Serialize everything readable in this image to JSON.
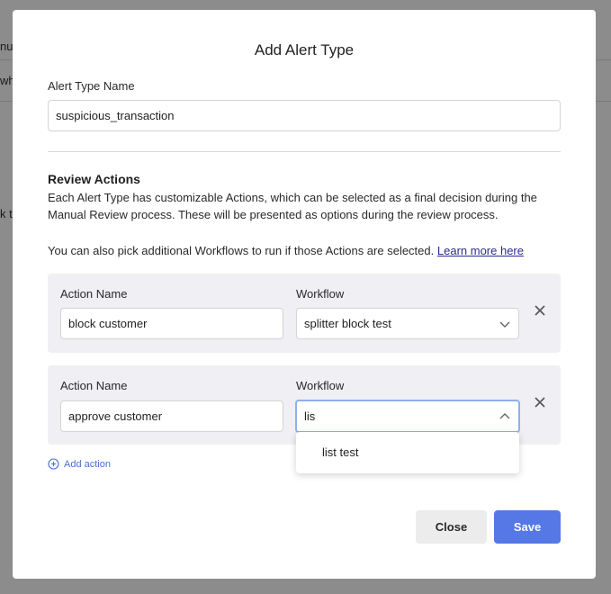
{
  "background": {
    "fragments": [
      "nua",
      "wh",
      "k t",
      "."
    ]
  },
  "modal": {
    "title": "Add Alert Type",
    "alert_type_name_label": "Alert Type Name",
    "alert_type_name_value": "suspicious_transaction",
    "review_actions_title": "Review Actions",
    "description_1": "Each Alert Type has customizable Actions, which can be selected as a final decision during the Manual Review process. These will be presented as options during the review process.",
    "description_2": "You can also pick additional Workflows to run if those Actions are selected.",
    "learn_more": "Learn more here",
    "actions": [
      {
        "action_name_label": "Action Name",
        "action_name_value": "block customer",
        "workflow_label": "Workflow",
        "workflow_value": "splitter block test"
      },
      {
        "action_name_label": "Action Name",
        "action_name_value": "approve customer",
        "workflow_label": "Workflow",
        "workflow_value": "lis"
      }
    ],
    "dropdown_options": [
      "list test"
    ],
    "add_action": "Add action",
    "close_button": "Close",
    "save_button": "Save"
  },
  "colors": {
    "primary": "#5578e6",
    "link": "#4a6fd1",
    "card_bg": "#efeff4",
    "focus_border": "#8fb0ea"
  },
  "icons": {
    "chevron_down": "chevron-down-icon",
    "chevron_up": "chevron-up-icon",
    "close": "close-icon",
    "add": "plus-circle-icon"
  }
}
